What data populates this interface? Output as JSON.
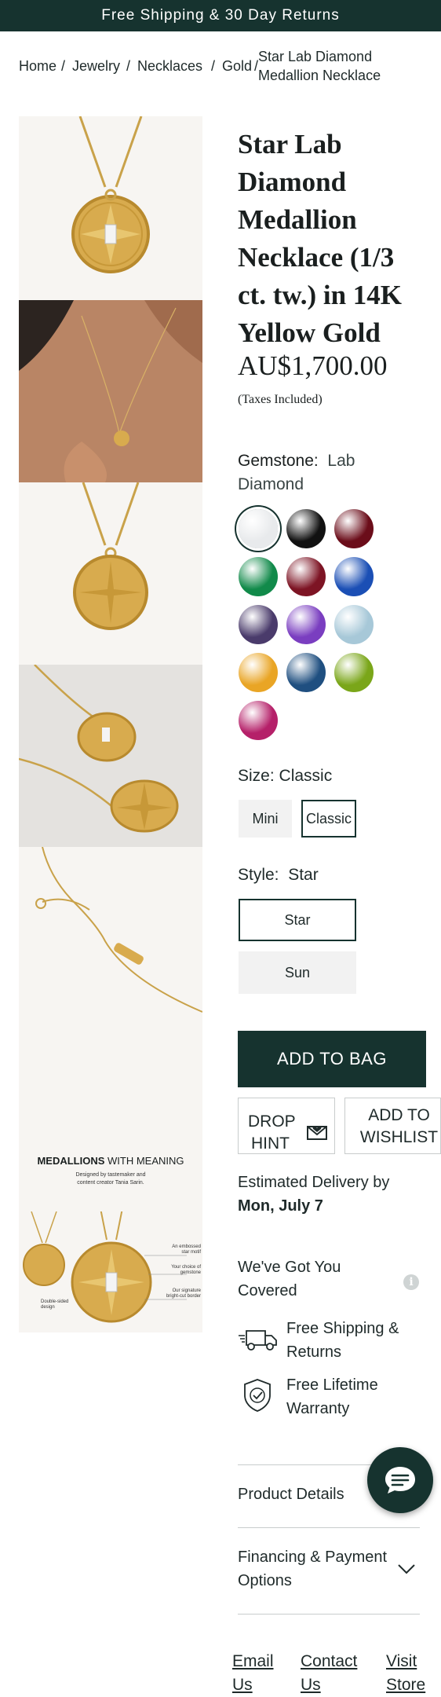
{
  "banner": {
    "text": "Free Shipping & 30 Day Returns"
  },
  "breadcrumb": {
    "items": [
      "Home",
      "Jewelry",
      "Necklaces",
      "Gold"
    ],
    "current_line1": "Star Lab Diamond",
    "current_line2": "Medallion Necklace",
    "separator": "/"
  },
  "gallery": {
    "infographic_title_bold": "MEDALLIONS",
    "infographic_title_rest": " WITH MEANING",
    "designed_line1": "Designed by tastemaker and",
    "designed_line2": "content creator Tania Sarin.",
    "callout_1a": "An embossed",
    "callout_1b": "star motif",
    "callout_2a": "Your choice of",
    "callout_2b": "gemstone",
    "callout_3a": "Our signature",
    "callout_3b": "bright-cut border",
    "callout_4a": "Double-sided",
    "callout_4b": "design"
  },
  "product": {
    "title_lines": [
      "Star Lab",
      "Diamond",
      "Medallion",
      "Necklace (1/3",
      "ct. tw.) in 14K",
      "Yellow Gold"
    ],
    "price": "AU$1,700.00",
    "taxes": "(Taxes Included)"
  },
  "gemstone": {
    "label": "Gemstone:",
    "value_line1": "Lab",
    "value_line2": "Diamond",
    "swatches": [
      {
        "name": "lab-diamond",
        "color": "#e8eaec",
        "selected": true
      },
      {
        "name": "black",
        "color": "#111111"
      },
      {
        "name": "ruby",
        "color": "#6b0d1a"
      },
      {
        "name": "emerald",
        "color": "#118a4a"
      },
      {
        "name": "garnet",
        "color": "#7d1424"
      },
      {
        "name": "sapphire",
        "color": "#1b4fb5"
      },
      {
        "name": "alexandrite",
        "color": "#4a3b6b"
      },
      {
        "name": "amethyst",
        "color": "#7a3ec0"
      },
      {
        "name": "aquamarine",
        "color": "#a7c8d8"
      },
      {
        "name": "citrine",
        "color": "#e9a525"
      },
      {
        "name": "london-blue-topaz",
        "color": "#1f4f80"
      },
      {
        "name": "peridot",
        "color": "#7aa619"
      },
      {
        "name": "pink-tourmaline",
        "color": "#b52069"
      }
    ]
  },
  "size": {
    "label": "Size:",
    "value": "Classic",
    "options": [
      {
        "label": "Mini",
        "selected": false
      },
      {
        "label": "Classic",
        "selected": true
      }
    ]
  },
  "style": {
    "label": "Style:",
    "value": "Star",
    "options": [
      {
        "label": "Star",
        "selected": true
      },
      {
        "label": "Sun",
        "selected": false
      }
    ]
  },
  "actions": {
    "add_to_bag": "ADD TO BAG",
    "drop_hint_line1": "DROP",
    "drop_hint_line2": "HINT",
    "wishlist_line1": "ADD TO",
    "wishlist_line2": "WISHLIST"
  },
  "delivery": {
    "label": "Estimated Delivery by",
    "date": "Mon, July 7"
  },
  "covered": {
    "title_line1": "We've Got You",
    "title_line2": "Covered",
    "features": [
      {
        "line1": "Free Shipping &",
        "line2": "Returns",
        "icon": "truck-icon"
      },
      {
        "line1": "Free Lifetime",
        "line2": "Warranty",
        "icon": "shield-check-icon"
      }
    ]
  },
  "accordion": {
    "product_details": "Product Details",
    "financing_line1": "Financing & Payment",
    "financing_line2": "Options"
  },
  "footer": {
    "links": [
      {
        "line1": "Email",
        "line2": "Us"
      },
      {
        "line1": "Contact",
        "line2": "Us"
      },
      {
        "line1": "Visit",
        "line2": "Store"
      }
    ]
  },
  "colors": {
    "brand_dark": "#16332f",
    "gold": "#d8ab4e"
  }
}
